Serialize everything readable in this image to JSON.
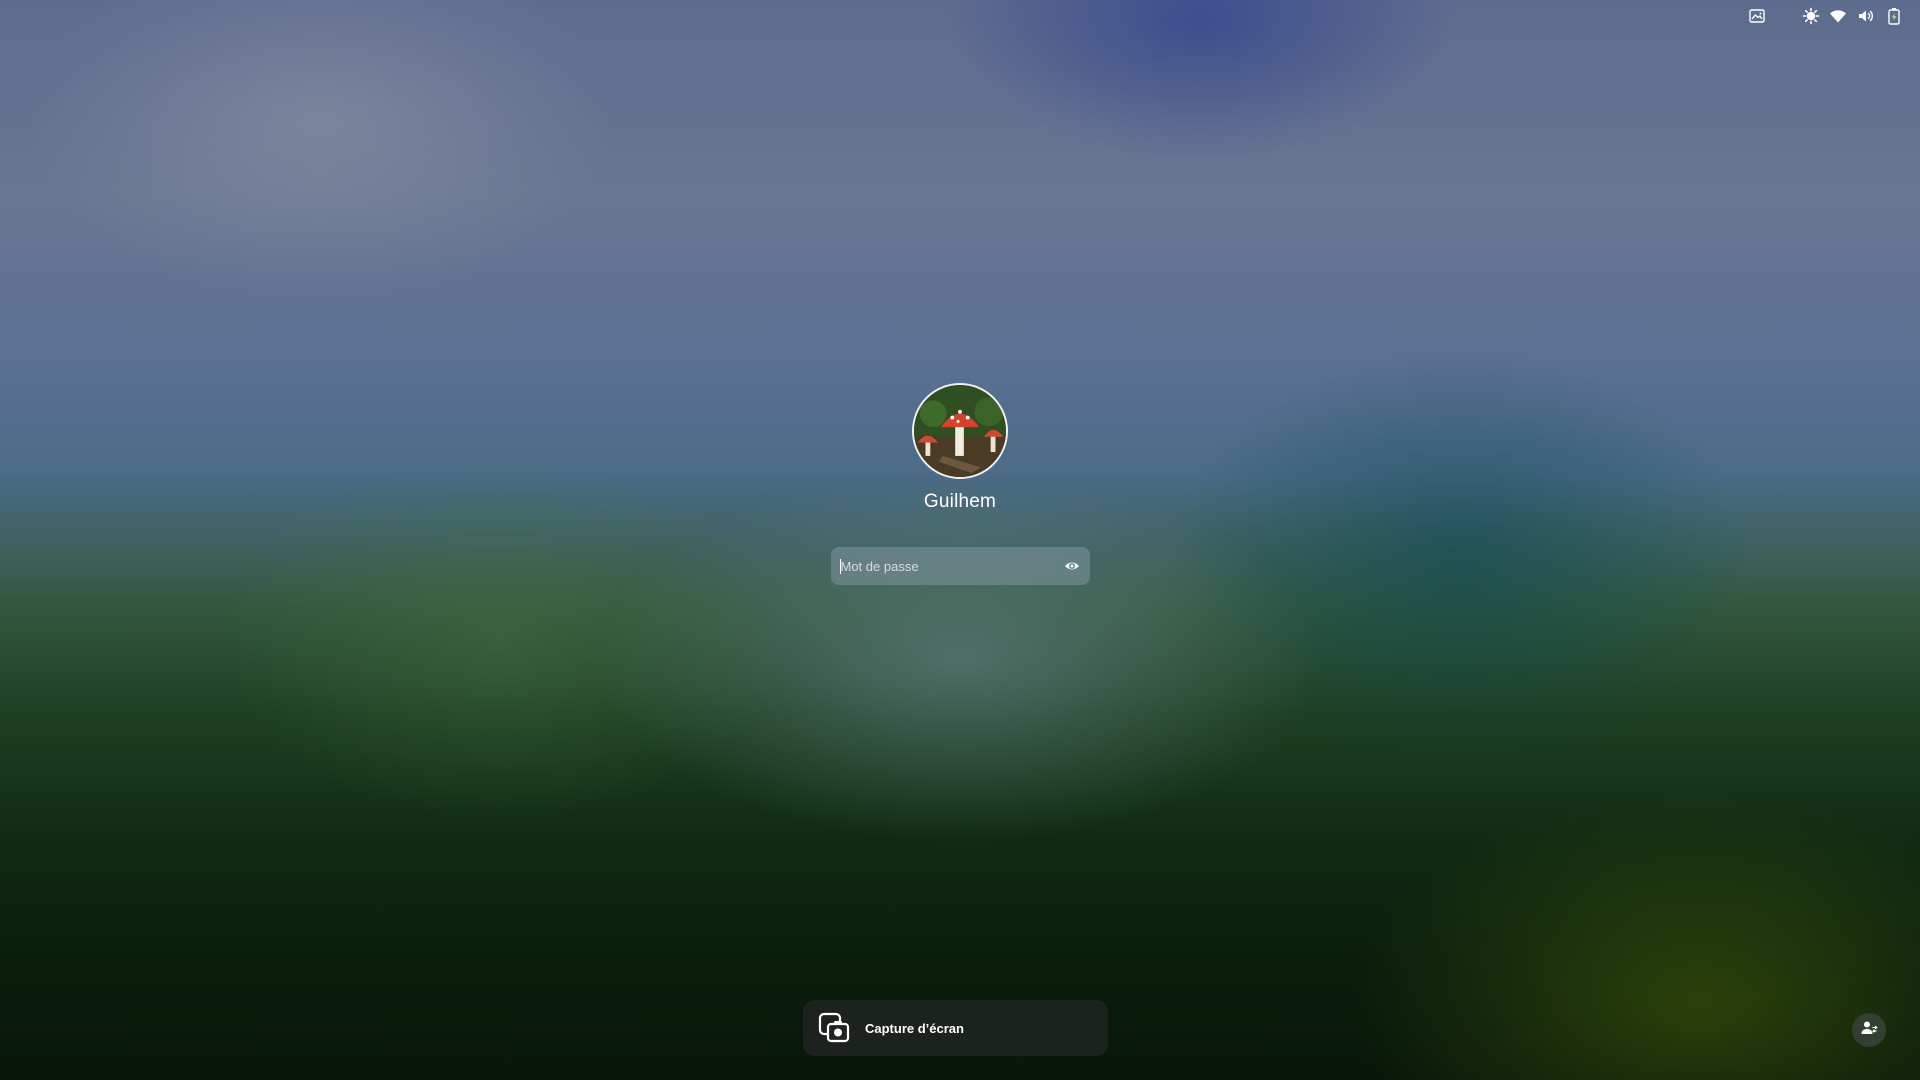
{
  "top_bar": {
    "icons": [
      {
        "name": "screen-image-icon"
      },
      {
        "name": "brightness-icon"
      },
      {
        "name": "wifi-icon"
      },
      {
        "name": "volume-icon"
      },
      {
        "name": "battery-charging-icon"
      }
    ]
  },
  "login": {
    "username": "Guilhem",
    "password_placeholder": "Mot de passe",
    "password_value": "",
    "reveal_icon": "eye-icon"
  },
  "notification": {
    "icon": "screenshot-icon",
    "title": "Capture d’écran"
  },
  "switch_user": {
    "icon": "switch-user-icon"
  }
}
